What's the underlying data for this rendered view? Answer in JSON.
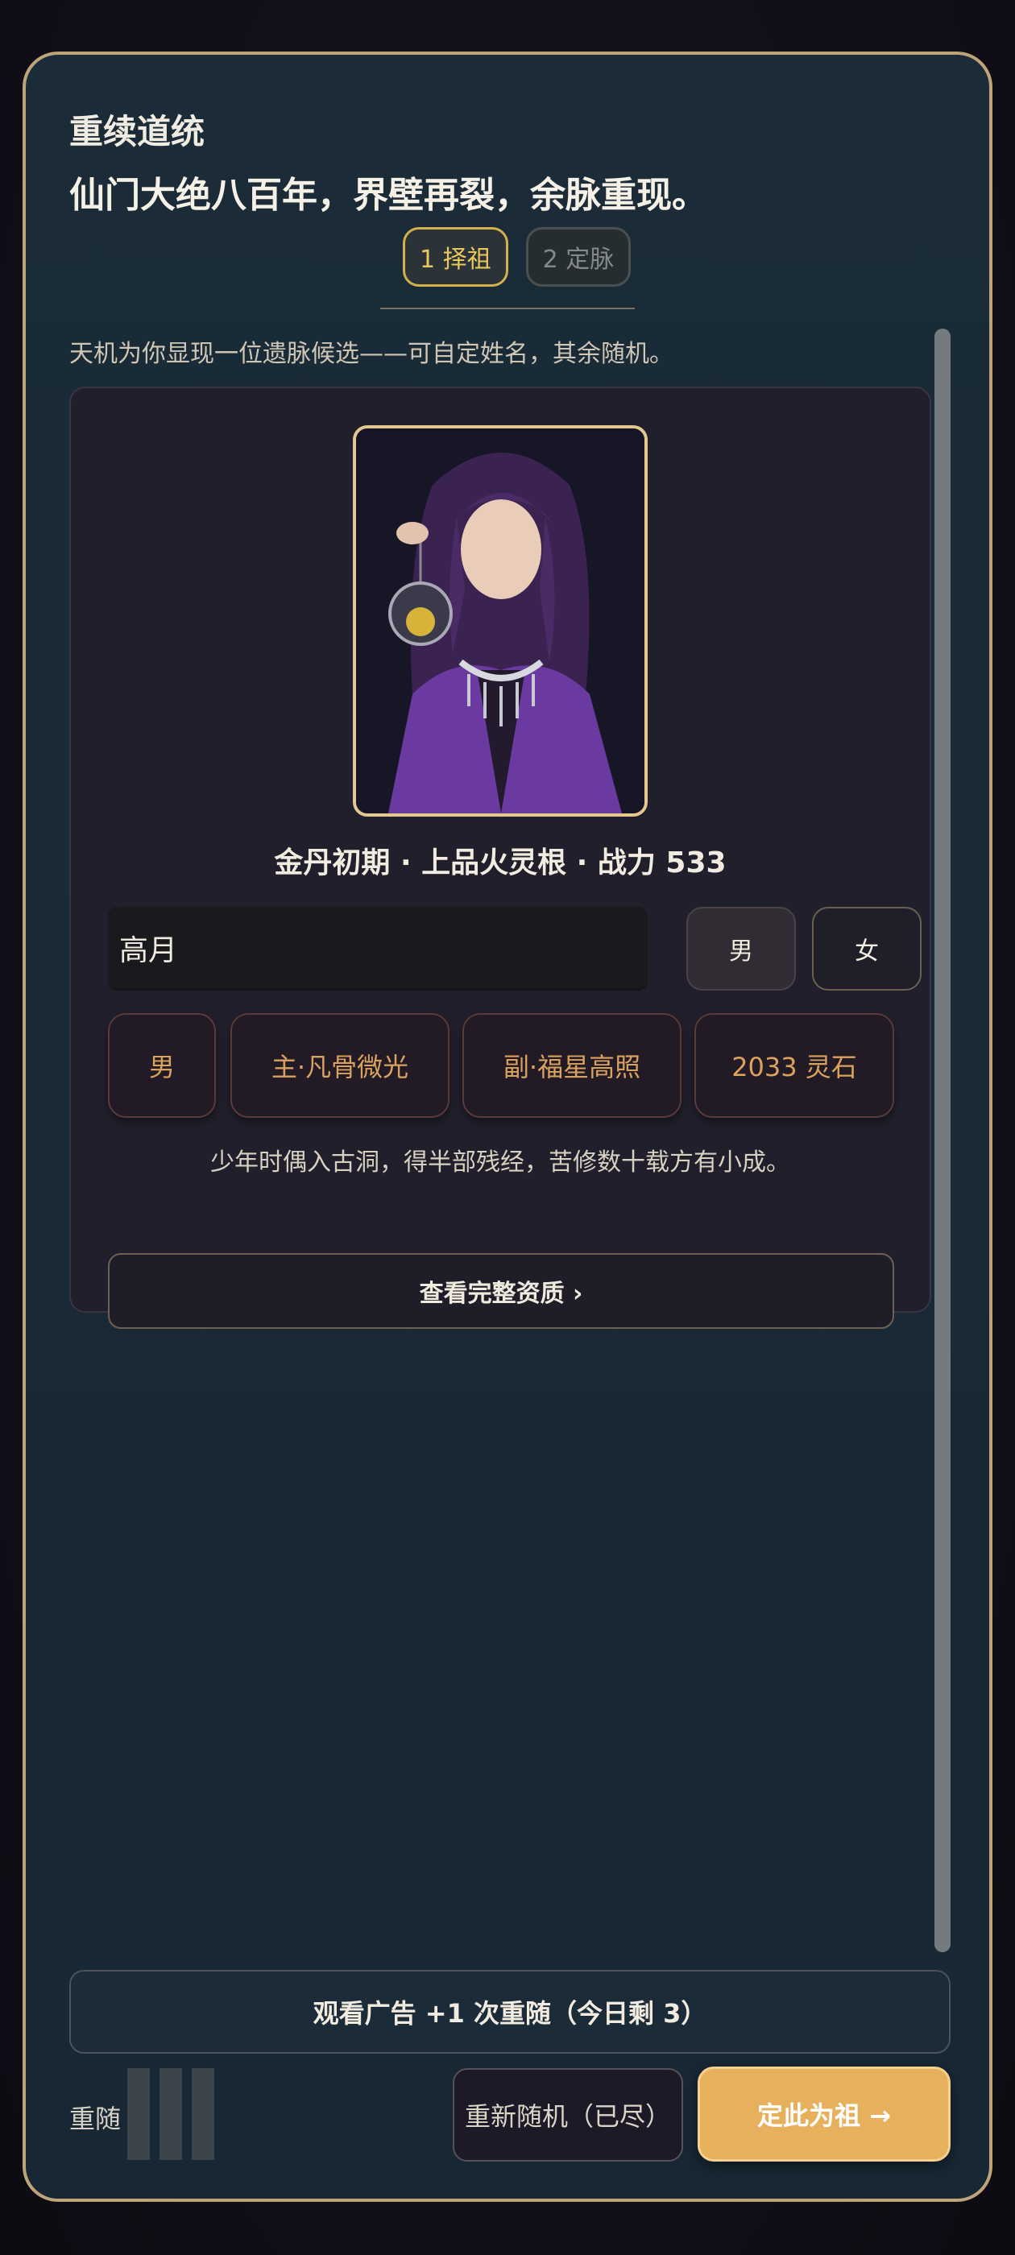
{
  "header": {
    "title_small": "重续道统",
    "title_large": "仙门大绝八百年，界壁再裂，余脉重现。",
    "steps": [
      {
        "label": "1 择祖",
        "active": true
      },
      {
        "label": "2 定脉",
        "active": false
      }
    ],
    "subtitle": "天机为你显现一位遗脉候选——可自定姓名，其余随机。"
  },
  "candidate": {
    "portrait_icon": "character-portrait",
    "stats": "金丹初期 · 上品火灵根 · 战力 533",
    "name_value": "高月",
    "gender_options": [
      "男",
      "女"
    ],
    "selected_gender": "男",
    "tags": [
      "男",
      "主·凡骨微光",
      "副·福星高照",
      "2033 灵石"
    ],
    "description": "少年时偶入古洞，得半部残经，苦修数十载方有小成。",
    "view_full_label": "查看完整资质 ›"
  },
  "footer": {
    "ad_button": "观看广告 +1 次重随（今日剩 3）",
    "reroll_label": "重随",
    "reroll_used": 3,
    "reroll_button": "重新随机（已尽）",
    "confirm_button": "定此为祖 →"
  },
  "colors": {
    "accent_gold": "#e6b05c",
    "frame_border": "#bfa47a",
    "active_step": "#e9c85b",
    "tag_text": "#d9a25e"
  }
}
